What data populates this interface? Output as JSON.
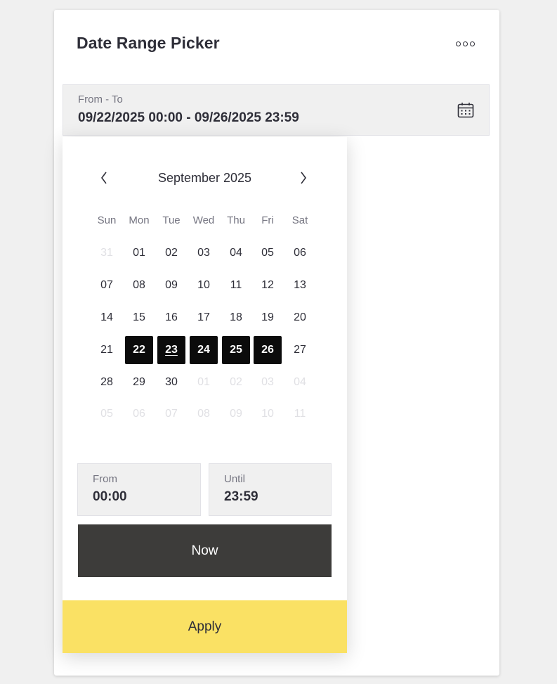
{
  "card": {
    "title": "Date Range Picker",
    "more_icon": "more-horizontal-icon"
  },
  "range_field": {
    "label": "From - To",
    "value": "09/22/2025 00:00 - 09/26/2025 23:59",
    "icon": "calendar-icon"
  },
  "calendar": {
    "month_title": "September 2025",
    "prev_icon": "chevron-left-icon",
    "next_icon": "chevron-right-icon",
    "weekdays": [
      "Sun",
      "Mon",
      "Tue",
      "Wed",
      "Thu",
      "Fri",
      "Sat"
    ],
    "weeks": [
      [
        {
          "d": "31",
          "m": true
        },
        {
          "d": "01"
        },
        {
          "d": "02"
        },
        {
          "d": "03"
        },
        {
          "d": "04"
        },
        {
          "d": "05"
        },
        {
          "d": "06"
        }
      ],
      [
        {
          "d": "07"
        },
        {
          "d": "08"
        },
        {
          "d": "09"
        },
        {
          "d": "10"
        },
        {
          "d": "11"
        },
        {
          "d": "12"
        },
        {
          "d": "13"
        }
      ],
      [
        {
          "d": "14"
        },
        {
          "d": "15"
        },
        {
          "d": "16"
        },
        {
          "d": "17"
        },
        {
          "d": "18"
        },
        {
          "d": "19"
        },
        {
          "d": "20"
        }
      ],
      [
        {
          "d": "21"
        },
        {
          "d": "22",
          "sel": true
        },
        {
          "d": "23",
          "sel": true,
          "today": true
        },
        {
          "d": "24",
          "sel": true
        },
        {
          "d": "25",
          "sel": true
        },
        {
          "d": "26",
          "sel": true
        },
        {
          "d": "27"
        }
      ],
      [
        {
          "d": "28"
        },
        {
          "d": "29"
        },
        {
          "d": "30"
        },
        {
          "d": "01",
          "m": true
        },
        {
          "d": "02",
          "m": true
        },
        {
          "d": "03",
          "m": true
        },
        {
          "d": "04",
          "m": true
        }
      ],
      [
        {
          "d": "05",
          "m": true
        },
        {
          "d": "06",
          "m": true
        },
        {
          "d": "07",
          "m": true
        },
        {
          "d": "08",
          "m": true
        },
        {
          "d": "09",
          "m": true
        },
        {
          "d": "10",
          "m": true
        },
        {
          "d": "11",
          "m": true
        }
      ]
    ]
  },
  "time": {
    "from_label": "From",
    "from_value": "00:00",
    "until_label": "Until",
    "until_value": "23:59"
  },
  "buttons": {
    "now": "Now",
    "apply": "Apply"
  },
  "colors": {
    "selected_bg": "#0b0b0b",
    "now_bg": "#3d3c3a",
    "apply_bg": "#fae164",
    "field_bg": "#f0f0f0"
  }
}
